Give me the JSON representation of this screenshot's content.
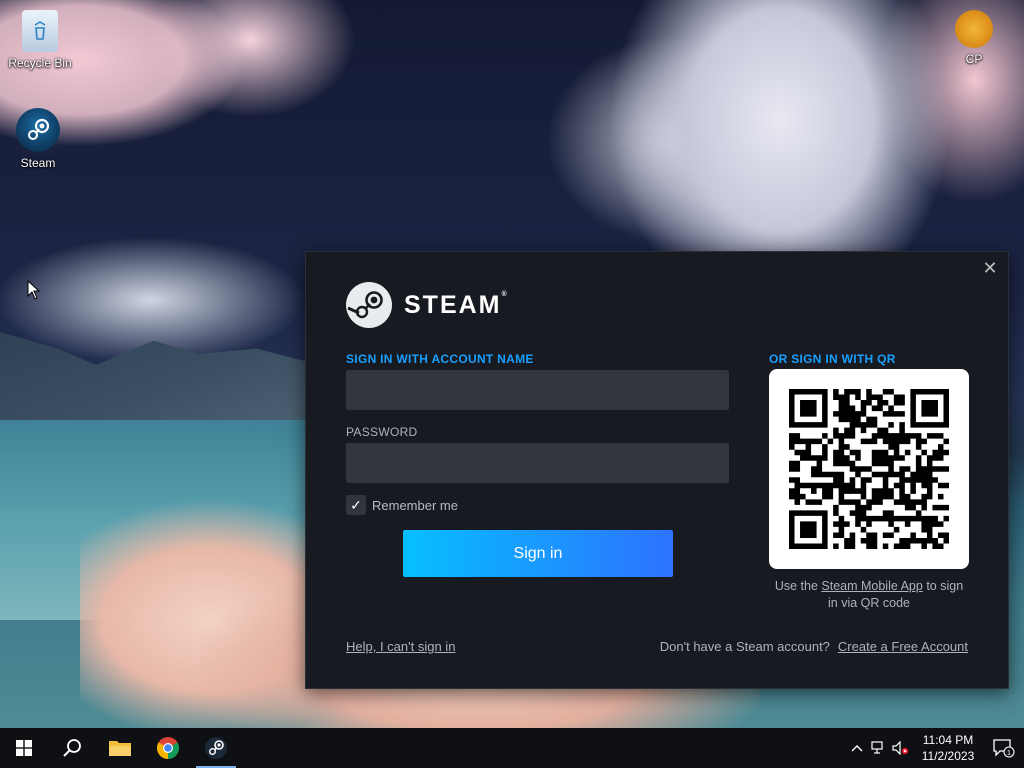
{
  "desktop": {
    "icons": [
      {
        "label": "Recycle Bin",
        "icon": "recycle-bin-icon"
      },
      {
        "label": "Steam",
        "icon": "steam-icon"
      },
      {
        "label": "CP",
        "icon": "cp-icon"
      }
    ]
  },
  "dialog": {
    "brand": "STEAM",
    "close": "✕",
    "account_label": "SIGN IN WITH ACCOUNT NAME",
    "account_value": "",
    "password_label": "PASSWORD",
    "password_value": "",
    "remember_label": "Remember me",
    "remember_checked": true,
    "signin_label": "Sign in",
    "help_link": "Help, I can't sign in",
    "qr_label": "OR SIGN IN WITH QR",
    "qr_caption_pre": "Use the ",
    "qr_caption_link": "Steam Mobile App",
    "qr_caption_post": " to sign in via QR code",
    "no_account_text": "Don't have a Steam account?",
    "create_account_link": "Create a Free Account",
    "colors": {
      "accent": "#1a9fff",
      "bg": "#181a21",
      "field": "#32353c",
      "button_start": "#06bfff",
      "button_end": "#2d73ff"
    }
  },
  "taskbar": {
    "apps": [
      "start-icon",
      "search-icon",
      "file-explorer-icon",
      "chrome-icon",
      "steam-icon"
    ],
    "active_app": "steam-icon",
    "clock_time": "11:04 PM",
    "clock_date": "11/2/2023",
    "notification_count": "1"
  }
}
